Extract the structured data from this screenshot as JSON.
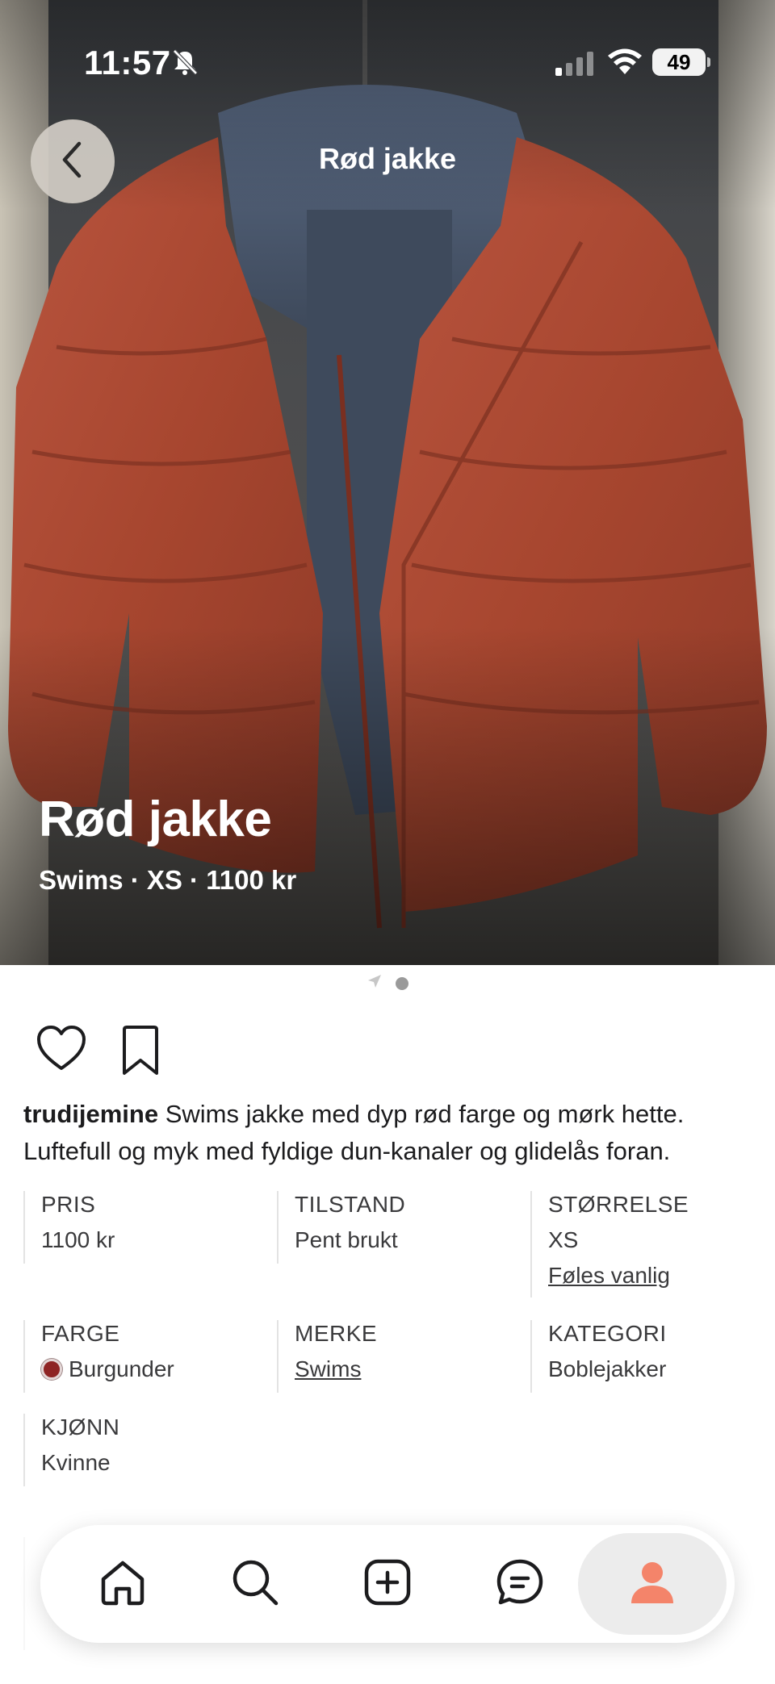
{
  "status_bar": {
    "time": "11:57",
    "battery": "49",
    "icons": [
      "bell-slash-icon",
      "signal-icon",
      "wifi-icon",
      "battery-icon"
    ]
  },
  "nav": {
    "back_icon": "chevron-left-icon",
    "title": "Rød jakke"
  },
  "hero": {
    "title": "Rød jakke",
    "subtitle": "Swims · XS · 1100 kr",
    "pager_icons": [
      "location-arrow-icon",
      "dot-icon"
    ]
  },
  "actions": {
    "like_icon": "heart-icon",
    "save_icon": "bookmark-icon"
  },
  "description": {
    "username": "trudijemine",
    "text": " Swims jakke med dyp rød farge og mørk hette. Luftefull og myk med fyldige dun-kanaler og glidelås foran."
  },
  "attributes": {
    "price": {
      "label": "PRIS",
      "value": "1100 kr"
    },
    "condition": {
      "label": "TILSTAND",
      "value": "Pent brukt"
    },
    "size": {
      "label": "STØRRELSE",
      "value": "XS",
      "link": "Føles vanlig"
    },
    "color": {
      "label": "FARGE",
      "value": "Burgunder",
      "swatch": "#8e2424"
    },
    "brand": {
      "label": "MERKE",
      "value": "Swims"
    },
    "category": {
      "label": "KATEGORI",
      "value": "Boblejakker"
    },
    "gender": {
      "label": "KJØNN",
      "value": "Kvinne"
    }
  },
  "tab_bar": {
    "tabs": [
      "home-icon",
      "search-icon",
      "add-icon",
      "chat-icon",
      "profile-icon"
    ],
    "active": "profile-icon",
    "accent": "#f4846a"
  }
}
